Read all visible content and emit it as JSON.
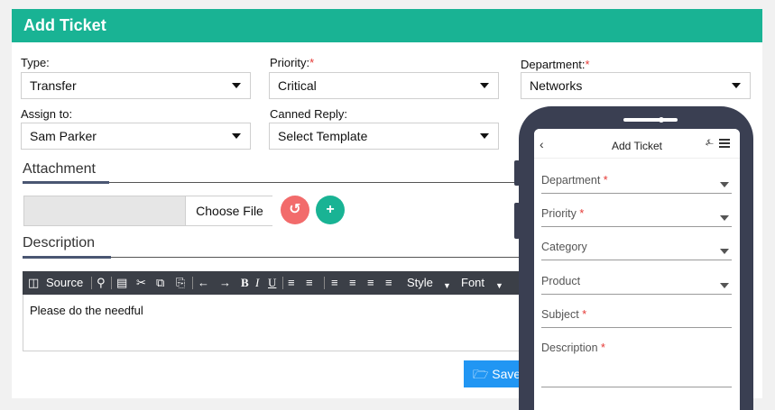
{
  "header": {
    "title": "Add Ticket"
  },
  "form": {
    "type": {
      "label": "Type:",
      "value": "Transfer"
    },
    "priority": {
      "label": "Priority:",
      "required": "*",
      "value": "Critical"
    },
    "department": {
      "label": "Department:",
      "required": "*",
      "value": "Networks"
    },
    "assign_to": {
      "label": "Assign to:",
      "value": "Sam Parker"
    },
    "canned_reply": {
      "label": "Canned Reply:",
      "value": "Select Template"
    }
  },
  "attachment": {
    "title": "Attachment",
    "choose_file": "Choose File"
  },
  "description": {
    "title": "Description",
    "content": "Please do the needful"
  },
  "toolbar": {
    "source": "Source",
    "style": "Style",
    "font": "Font"
  },
  "actions": {
    "save": "Save"
  },
  "colors": {
    "header": "#19b394",
    "reset": "#f26b6b",
    "add": "#19b394",
    "save": "#2196f3",
    "phone": "#3a3f52"
  },
  "mobile": {
    "title": "Add Ticket",
    "fields": {
      "department": {
        "label": "Department",
        "required": "*"
      },
      "priority": {
        "label": "Priority",
        "required": "*"
      },
      "category": {
        "label": "Category"
      },
      "product": {
        "label": "Product"
      },
      "subject": {
        "label": "Subject",
        "required": "*"
      },
      "description": {
        "label": "Description",
        "required": "*"
      }
    }
  }
}
